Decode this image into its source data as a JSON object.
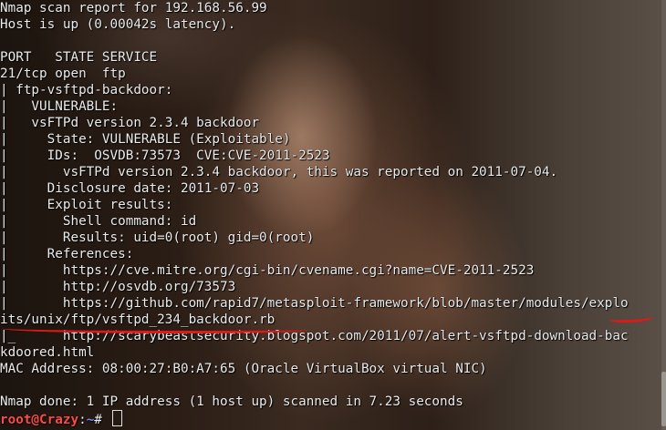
{
  "terminal": {
    "lines": [
      "Nmap scan report for 192.168.56.99",
      "Host is up (0.00042s latency).",
      "",
      "PORT   STATE SERVICE",
      "21/tcp open  ftp",
      "| ftp-vsftpd-backdoor:",
      "|   VULNERABLE:",
      "|   vsFTPd version 2.3.4 backdoor",
      "|     State: VULNERABLE (Exploitable)",
      "|     IDs:  OSVDB:73573  CVE:CVE-2011-2523",
      "|       vsFTPd version 2.3.4 backdoor, this was reported on 2011-07-04.",
      "|     Disclosure date: 2011-07-03",
      "|     Exploit results:",
      "|       Shell command: id",
      "|       Results: uid=0(root) gid=0(root)",
      "|     References:",
      "|       https://cve.mitre.org/cgi-bin/cvename.cgi?name=CVE-2011-2523",
      "|       http://osvdb.org/73573",
      "|       https://github.com/rapid7/metasploit-framework/blob/master/modules/explo",
      "its/unix/ftp/vsftpd_234_backdoor.rb",
      "|_      http://scarybeastsecurity.blogspot.com/2011/07/alert-vsftpd-download-bac",
      "kdoored.html",
      "MAC Address: 08:00:27:B0:A7:65 (Oracle VirtualBox virtual NIC)",
      "",
      "Nmap done: 1 IP address (1 host up) scanned in 7.23 seconds"
    ],
    "prompt": {
      "user_host": "root@Crazy",
      "separator": ":",
      "path": "~",
      "symbol": "# "
    }
  },
  "colors": {
    "text": "#ececec",
    "prompt_user": "#ff4a4a",
    "prompt_path": "#6c8cff",
    "annotation": "#e01818"
  }
}
